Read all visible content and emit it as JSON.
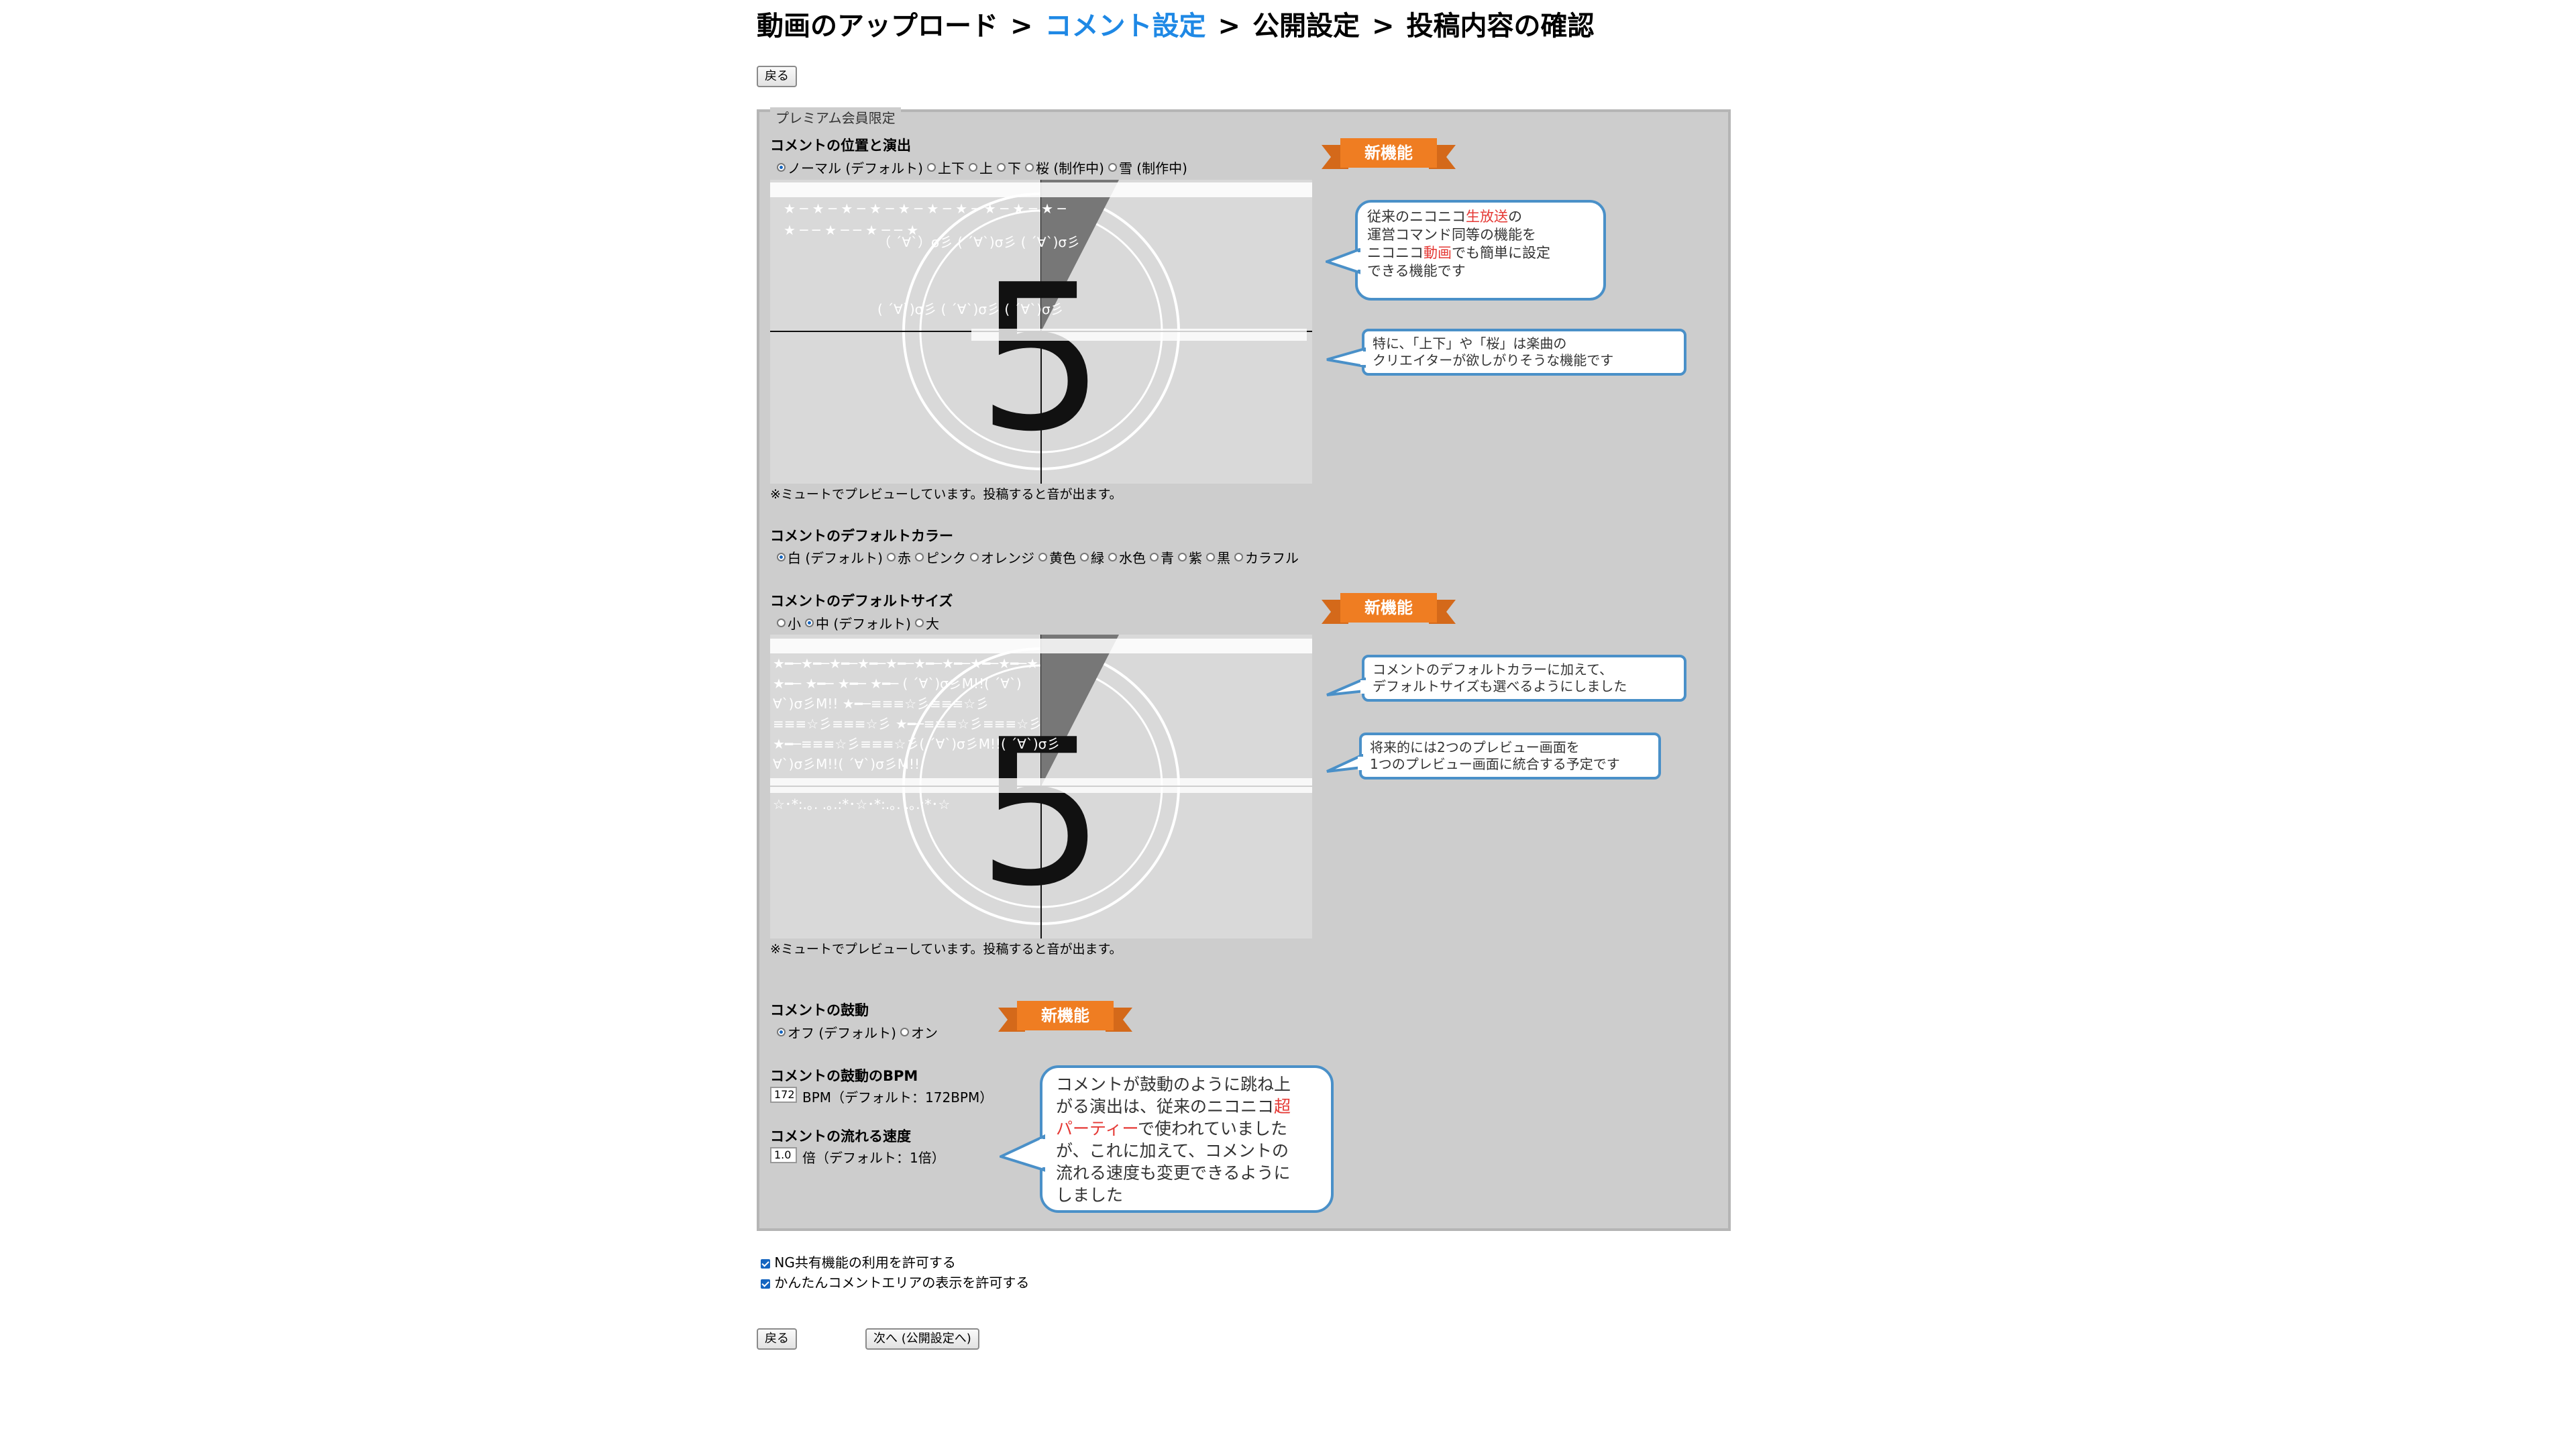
{
  "breadcrumb": {
    "step1": "動画のアップロード",
    "step2": "コメント設定",
    "step3": "公開設定",
    "step4": "投稿内容の確認",
    "separator": ">"
  },
  "buttons": {
    "back_top": "戻る",
    "back_bottom": "戻る",
    "next": "次へ (公開設定へ)"
  },
  "premium": {
    "legend": "プレミアム会員限定",
    "position": {
      "label": "コメントの位置と演出",
      "options": [
        "ノーマル (デフォルト)",
        "上下",
        "上",
        "下",
        "桜 (制作中)",
        "雪 (制作中)"
      ],
      "selected": 0
    },
    "preview_note_1": "※ミュートでプレビューしています。投稿すると音が出ます。",
    "color": {
      "label": "コメントのデフォルトカラー",
      "options": [
        "白 (デフォルト)",
        "赤",
        "ピンク",
        "オレンジ",
        "黄色",
        "緑",
        "水色",
        "青",
        "紫",
        "黒",
        "カラフル"
      ],
      "selected": 0
    },
    "size": {
      "label": "コメントのデフォルトサイズ",
      "options": [
        "小",
        "中 (デフォルト)",
        "大"
      ],
      "selected": 1
    },
    "preview_note_2": "※ミュートでプレビューしています。投稿すると音が出ます。",
    "beat": {
      "label": "コメントの鼓動",
      "options": [
        "オフ (デフォルト)",
        "オン"
      ],
      "selected": 0
    },
    "bpm": {
      "label": "コメントの鼓動のBPM",
      "value": "172",
      "unit_text": "BPM（デフォルト：172BPM）"
    },
    "speed": {
      "label": "コメントの流れる速度",
      "value": "1.0",
      "unit_text": "倍（デフォルト：1倍）"
    },
    "countdown_digit": "5"
  },
  "badges": {
    "new_feature": "新機能"
  },
  "bubbles": {
    "b1": {
      "line1_a": "従来のニコニコ",
      "line1_red": "生放送",
      "line1_b": "の",
      "line2": "運営コマンド同等の機能を",
      "line3_a": "ニコニコ",
      "line3_red": "動画",
      "line3_b": "でも簡単に設定",
      "line4": "できる機能です"
    },
    "b2": {
      "line1": "特に、「上下」や「桜」は楽曲の",
      "line2": "クリエイターが欲しがりそうな機能です"
    },
    "b3": {
      "line1": "コメントのデフォルトカラーに加えて、",
      "line2": "デフォルトサイズも選べるようにしました"
    },
    "b4": {
      "line1": "将来的には2つのプレビュー画面を",
      "line2": "1つのプレビュー画面に統合する予定です"
    },
    "b5": {
      "line1": "コメントが鼓動のように跳ね上",
      "line2": "がる演出は、従来のニコニコ",
      "line2_red": "超",
      "line3_red": "パーティー",
      "line3": "で使われていました",
      "line4": "が、これに加えて、コメントの",
      "line5": "流れる速度も変更できるように",
      "line6": "しました"
    }
  },
  "checkboxes": {
    "ng_share": {
      "label": "NG共有機能の利用を許可する",
      "checked": true
    },
    "easy_comment": {
      "label": "かんたんコメントエリアの表示を許可する",
      "checked": true
    }
  },
  "colors": {
    "accent_blue": "#1e88e5",
    "badge_orange": "#ef7d22",
    "bubble_border": "#4a90c8",
    "red_text": "#e53935"
  }
}
